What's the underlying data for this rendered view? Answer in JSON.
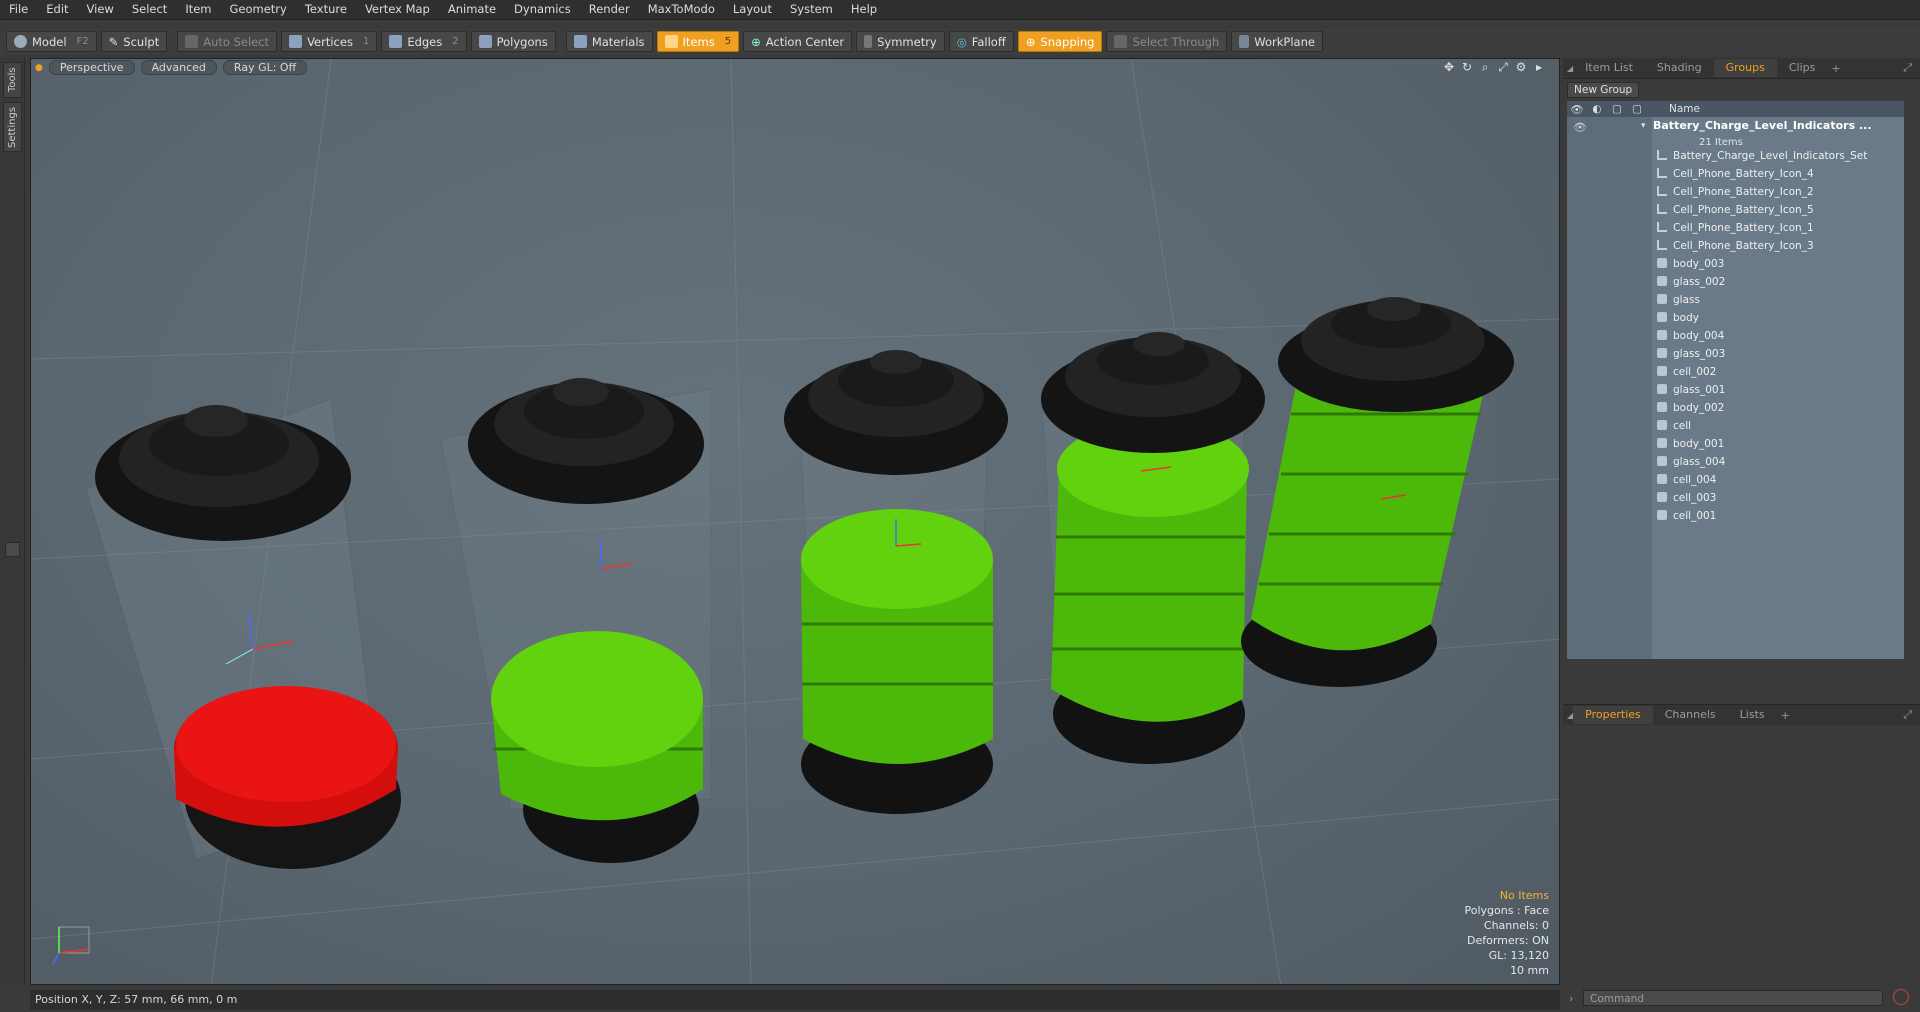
{
  "menu": [
    "File",
    "Edit",
    "View",
    "Select",
    "Item",
    "Geometry",
    "Texture",
    "Vertex Map",
    "Animate",
    "Dynamics",
    "Render",
    "MaxToModo",
    "Layout",
    "System",
    "Help"
  ],
  "toolbar": {
    "model": "Model",
    "model_key": "F2",
    "sculpt": "Sculpt",
    "auto_select": "Auto Select",
    "vertices": "Vertices",
    "vertices_key": "1",
    "edges": "Edges",
    "edges_key": "2",
    "polygons": "Polygons",
    "materials": "Materials",
    "items": "Items",
    "items_key": "5",
    "action_center": "Action Center",
    "symmetry": "Symmetry",
    "falloff": "Falloff",
    "snapping": "Snapping",
    "select_through": "Select Through",
    "workplane": "WorkPlane"
  },
  "left_tabs": [
    "Tools",
    "Settings"
  ],
  "viewport": {
    "view": "Perspective",
    "shading": "Advanced",
    "raygl": "Ray GL: Off",
    "stats": {
      "items": "No Items",
      "polygons": "Polygons : Face",
      "channels": "Channels: 0",
      "deformers": "Deformers: ON",
      "gl": "GL: 13,120",
      "scale": "10 mm"
    },
    "status": "Position X, Y, Z:   57 mm, 66 mm, 0 m",
    "batteries": [
      {
        "fill_color": "#e00d0d",
        "cells": 1
      },
      {
        "fill_color": "#5dcc0c",
        "cells": 2
      },
      {
        "fill_color": "#5dcc0c",
        "cells": 3
      },
      {
        "fill_color": "#5dcc0c",
        "cells": 4
      },
      {
        "fill_color": "#5dcc0c",
        "cells": 5
      }
    ]
  },
  "right_panel": {
    "tabs": [
      "Item List",
      "Shading",
      "Groups",
      "Clips"
    ],
    "new_group": "New Group",
    "name_col": "Name",
    "group_name": "Battery_Charge_Level_Indicators ...",
    "group_count": "21 Items",
    "items": [
      {
        "type": "locator",
        "label": "Battery_Charge_Level_Indicators_Set"
      },
      {
        "type": "locator",
        "label": "Cell_Phone_Battery_Icon_4"
      },
      {
        "type": "locator",
        "label": "Cell_Phone_Battery_Icon_2"
      },
      {
        "type": "locator",
        "label": "Cell_Phone_Battery_Icon_5"
      },
      {
        "type": "locator",
        "label": "Cell_Phone_Battery_Icon_1"
      },
      {
        "type": "locator",
        "label": "Cell_Phone_Battery_Icon_3"
      },
      {
        "type": "mesh",
        "label": "body_003"
      },
      {
        "type": "mesh",
        "label": "glass_002"
      },
      {
        "type": "mesh",
        "label": "glass"
      },
      {
        "type": "mesh",
        "label": "body"
      },
      {
        "type": "mesh",
        "label": "body_004"
      },
      {
        "type": "mesh",
        "label": "glass_003"
      },
      {
        "type": "mesh",
        "label": "cell_002"
      },
      {
        "type": "mesh",
        "label": "glass_001"
      },
      {
        "type": "mesh",
        "label": "body_002"
      },
      {
        "type": "mesh",
        "label": "cell"
      },
      {
        "type": "mesh",
        "label": "body_001"
      },
      {
        "type": "mesh",
        "label": "glass_004"
      },
      {
        "type": "mesh",
        "label": "cell_004"
      },
      {
        "type": "mesh",
        "label": "cell_003"
      },
      {
        "type": "mesh",
        "label": "cell_001"
      }
    ],
    "bottom_tabs": [
      "Properties",
      "Channels",
      "Lists"
    ],
    "command_placeholder": "Command"
  }
}
